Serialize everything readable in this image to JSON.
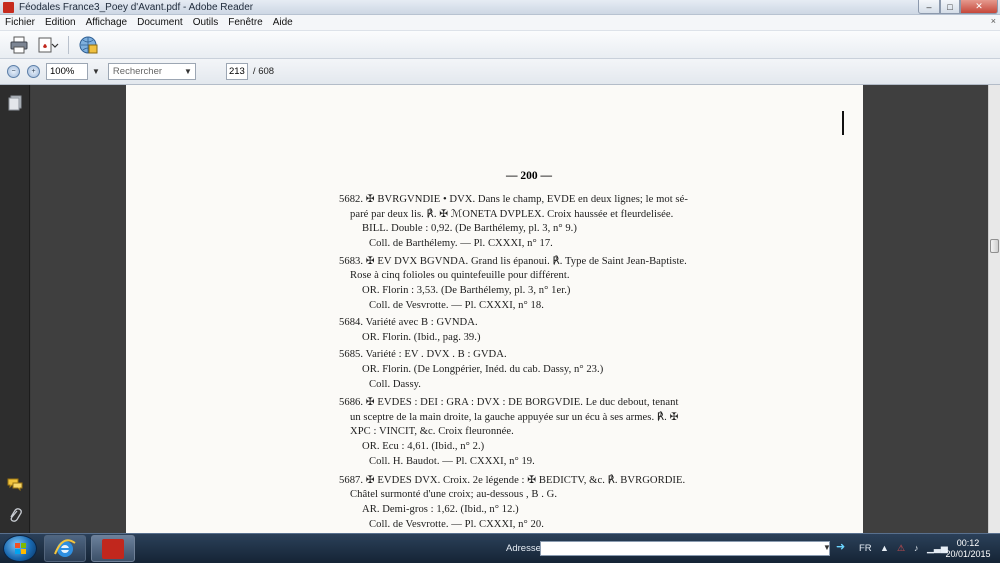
{
  "window": {
    "title": "Féodales France3_Poey d'Avant.pdf - Adobe Reader",
    "buttons": {
      "minimize": "–",
      "maximize": "□",
      "close": "✕"
    }
  },
  "menu": {
    "items": [
      "Fichier",
      "Edition",
      "Affichage",
      "Document",
      "Outils",
      "Fenêtre",
      "Aide"
    ],
    "close_doc": "×"
  },
  "toolbar": {
    "zoom": "100%",
    "search_placeholder": "Rechercher",
    "current_page": "213",
    "total_pages": "/ 608"
  },
  "page": {
    "page_number": "— 200 —",
    "lines": [
      "5682. ✠ BVRGVNDIE • DVX.  Dans le champ, EVDE en deux lignes;  le mot sé-",
      "paré par deux lis.  ℟. ✠ ℳONETA DVPLEX.  Croix haussée et fleurdelisée.",
      "BILL. Double : 0,92. (De Barthélemy, pl. 3, n° 9.)",
      "Coll. de Barthélemy. — Pl. CXXXI, n° 17.",
      "5683. ✠ EV DVX BGVNDA.  Grand lis épanoui.  ℟.  Type de Saint Jean-Baptiste.",
      "Rose à cinq folioles ou quintefeuille pour différent.",
      "OR. Florin : 3,53. (De Barthélemy, pl. 3, n° 1er.)",
      "Coll. de Vesvrotte. — Pl. CXXXI, n° 18.",
      "5684.  Variété avec B : GVNDA.",
      "OR. Florin. (Ibid., pag. 39.)",
      "5685.  Variété : EV . DVX . B : GVDA.",
      "OR. Florin. (De Longpérier, Inéd. du cab. Dassy, n° 23.)",
      "Coll. Dassy.",
      "5686. ✠ EVDES : DEI : GRA : DVX : DE BORGVDIE.  Le duc debout,  tenant",
      "un sceptre de la main droite,  la gauche appuyée sur un écu à ses armes.  ℟. ✠",
      "XPC : VINCIT, &c. Croix fleuronnée.",
      "OR. Ecu : 4,61. (Ibid., n° 2.)",
      "Coll. H. Baudot. — Pl. CXXXI, n° 19.",
      "5687. ✠ EVDES DVX. Croix.  2e légende : ✠ BEDICTV, &c. ℟. BVRGORDIE.",
      "Châtel surmonté d'une croix; au-dessous , B . G.",
      "AR. Demi-gros : 1,62. (Ibid., n° 12.)",
      "Coll. de Vesvrotte. — Pl. CXXXI, n° 20."
    ]
  },
  "taskbar": {
    "address_label": "Adresse",
    "language": "FR",
    "time": "00:12",
    "date": "20/01/2015"
  }
}
